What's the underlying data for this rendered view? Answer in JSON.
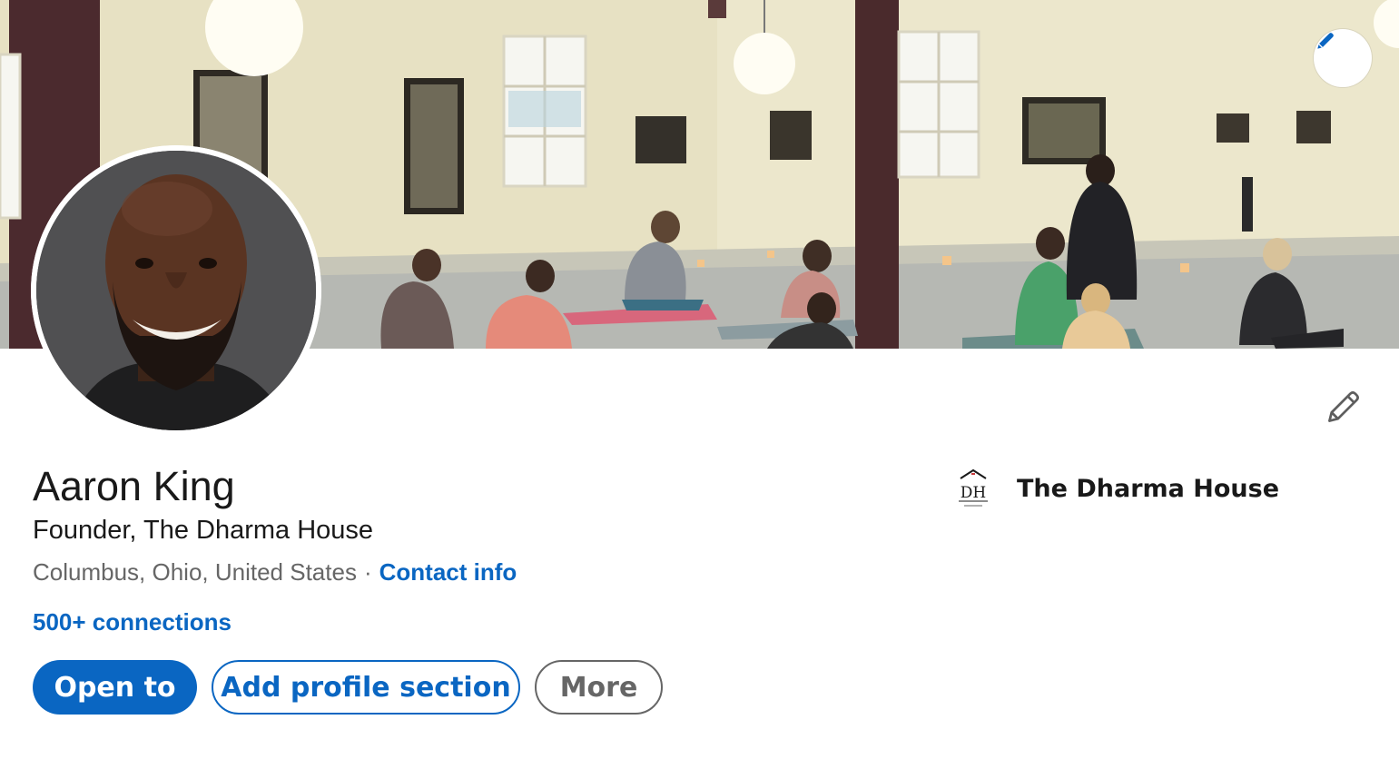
{
  "profile": {
    "name": "Aaron King",
    "headline": "Founder, The Dharma House",
    "location": "Columbus, Ohio, United States",
    "separator": "·",
    "contact_info_label": "Contact info",
    "connections_label": "500+ connections"
  },
  "actions": {
    "open_to_label": "Open to",
    "add_section_label": "Add profile section",
    "more_label": "More"
  },
  "experience": {
    "company_name": "The Dharma House",
    "logo_text": "DH"
  },
  "icons": {
    "banner_edit": "pencil-icon",
    "intro_edit": "pencil-icon",
    "company_logo": "company-logo"
  },
  "colors": {
    "brand_blue": "#0a66c2",
    "text_primary": "#191919",
    "text_secondary": "#666666"
  }
}
